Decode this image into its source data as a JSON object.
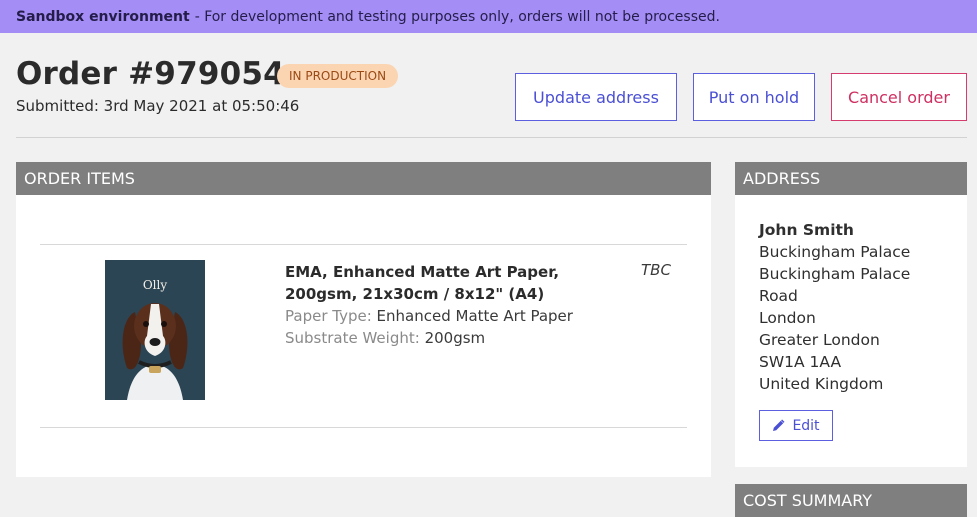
{
  "banner": {
    "bold": "Sandbox environment",
    "text": "- For development and testing purposes only, orders will not be processed."
  },
  "order": {
    "title": "Order #979054",
    "status": "IN PRODUCTION",
    "submitted": "Submitted: 3rd May 2021 at 05:50:46"
  },
  "actions": {
    "update_address": "Update address",
    "put_on_hold": "Put on hold",
    "cancel_order": "Cancel order"
  },
  "items": {
    "heading": "ORDER ITEMS",
    "list": [
      {
        "thumbnail_text": "Olly",
        "name": "EMA, Enhanced Matte Art Paper, 200gsm, 21x30cm / 8x12\" (A4)",
        "attr1_key": "Paper Type:",
        "attr1_val": "Enhanced Matte Art Paper",
        "attr2_key": "Substrate Weight:",
        "attr2_val": "200gsm",
        "price": "TBC"
      }
    ]
  },
  "address": {
    "heading": "ADDRESS",
    "name": "John Smith",
    "lines": [
      "Buckingham Palace",
      "Buckingham Palace",
      "Road",
      "London",
      "Greater London",
      "SW1A 1AA",
      "United Kingdom"
    ],
    "edit_label": "Edit"
  },
  "cost": {
    "heading": "COST SUMMARY"
  },
  "colors": {
    "banner": "#a48df5",
    "accent": "#5b5fe0",
    "danger": "#d63d6e",
    "badge_bg": "#fbd4b2",
    "card_header": "#7f7f7f"
  },
  "icons": {
    "edit": "pencil-icon"
  }
}
